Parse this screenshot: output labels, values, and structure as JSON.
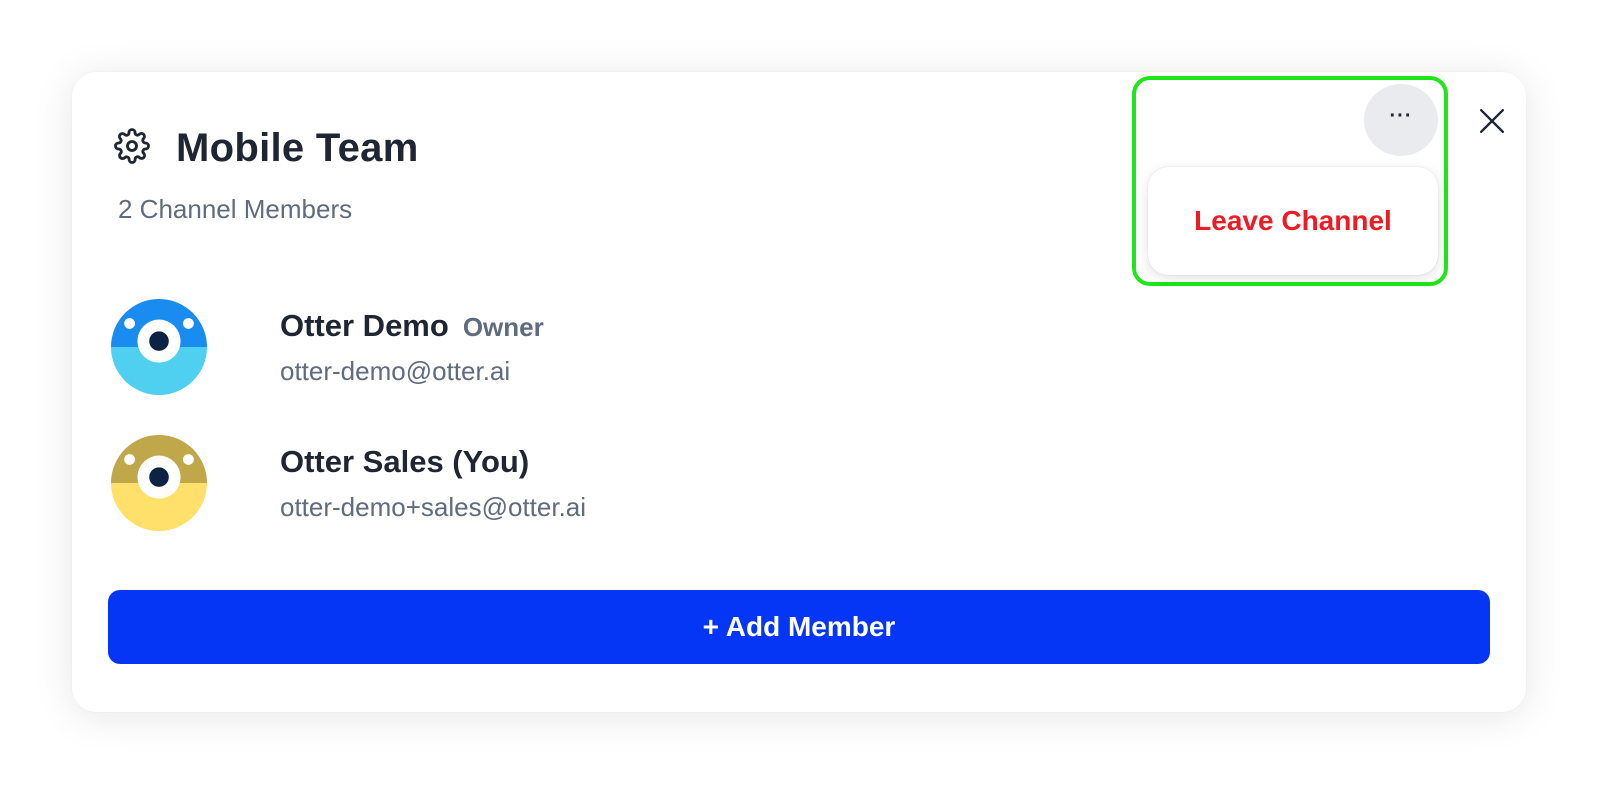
{
  "channel": {
    "title": "Mobile Team",
    "member_count_label": "2 Channel Members"
  },
  "members": [
    {
      "name": "Otter Demo",
      "role": "Owner",
      "email": "otter-demo@otter.ai",
      "avatar_icon": "otter-avatar-blue",
      "avatar_colors": {
        "top": "#1a8cf0",
        "bottom": "#4fd0f0"
      }
    },
    {
      "name": "Otter Sales (You)",
      "role": "",
      "email": "otter-demo+sales@otter.ai",
      "avatar_icon": "otter-avatar-yellow",
      "avatar_colors": {
        "top": "#bfa74a",
        "bottom": "#ffe06b"
      }
    }
  ],
  "actions": {
    "add_member_label": "+ Add Member",
    "more_label": "···",
    "menu_items": [
      {
        "label": "Leave Channel",
        "color": "#ed1c24"
      }
    ]
  },
  "icons": {
    "settings": "gear-icon",
    "more": "more-horizontal-icon",
    "close": "close-icon"
  },
  "colors": {
    "primary": "#0536f5",
    "highlight": "#1ee619",
    "danger": "#ed1c24",
    "text": "#1f2533",
    "muted": "#5f6b7e"
  }
}
